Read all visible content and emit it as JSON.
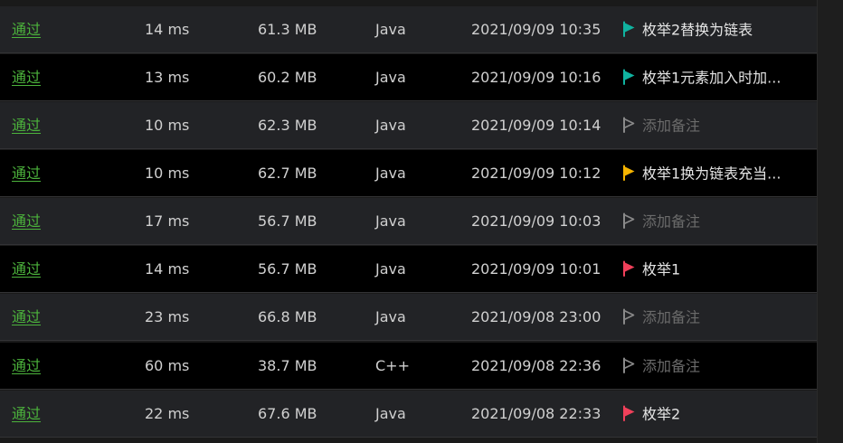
{
  "submissions": [
    {
      "status": "通过",
      "runtime": "14 ms",
      "memory": "61.3 MB",
      "language": "Java",
      "time": "2021/09/09 10:35",
      "note": "枚举2替换为链表",
      "flag_color": "#10b3a0",
      "note_filled": true
    },
    {
      "status": "通过",
      "runtime": "13 ms",
      "memory": "60.2 MB",
      "language": "Java",
      "time": "2021/09/09 10:16",
      "note": "枚举1元素加入时加...",
      "flag_color": "#10b3a0",
      "note_filled": true
    },
    {
      "status": "通过",
      "runtime": "10 ms",
      "memory": "62.3 MB",
      "language": "Java",
      "time": "2021/09/09 10:14",
      "note": "添加备注",
      "flag_color": "#8a8a8a",
      "note_filled": false
    },
    {
      "status": "通过",
      "runtime": "10 ms",
      "memory": "62.7 MB",
      "language": "Java",
      "time": "2021/09/09 10:12",
      "note": "枚举1换为链表充当...",
      "flag_color": "#f5b400",
      "note_filled": true
    },
    {
      "status": "通过",
      "runtime": "17 ms",
      "memory": "56.7 MB",
      "language": "Java",
      "time": "2021/09/09 10:03",
      "note": "添加备注",
      "flag_color": "#8a8a8a",
      "note_filled": false
    },
    {
      "status": "通过",
      "runtime": "14 ms",
      "memory": "56.7 MB",
      "language": "Java",
      "time": "2021/09/09 10:01",
      "note": "枚举1",
      "flag_color": "#f0405a",
      "note_filled": true
    },
    {
      "status": "通过",
      "runtime": "23 ms",
      "memory": "66.8 MB",
      "language": "Java",
      "time": "2021/09/08 23:00",
      "note": "添加备注",
      "flag_color": "#8a8a8a",
      "note_filled": false
    },
    {
      "status": "通过",
      "runtime": "60 ms",
      "memory": "38.7 MB",
      "language": "C++",
      "time": "2021/09/08 22:36",
      "note": "添加备注",
      "flag_color": "#8a8a8a",
      "note_filled": false
    },
    {
      "status": "通过",
      "runtime": "22 ms",
      "memory": "67.6 MB",
      "language": "Java",
      "time": "2021/09/08 22:33",
      "note": "枚举2",
      "flag_color": "#f0405a",
      "note_filled": true
    }
  ]
}
